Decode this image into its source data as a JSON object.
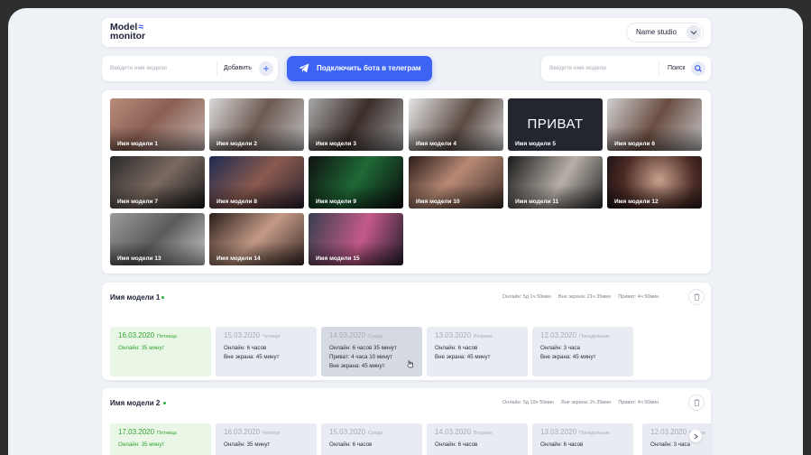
{
  "header": {
    "logo_line1": "Model",
    "logo_line2": "monitor",
    "logo_mark": "≈",
    "studio_name": "Name studio",
    "studio_chevron_icon": "chevron-down-icon"
  },
  "add_model": {
    "placeholder": "Введите имя модели",
    "button_label": "Добавить",
    "button_icon": "+"
  },
  "telegram": {
    "label": "Подключить бота в телеграм",
    "icon": "telegram-plane-icon"
  },
  "search": {
    "placeholder": "Введите имя модели",
    "button_label": "Поиск",
    "icon": "search-icon"
  },
  "gallery": [
    {
      "label": "Имя модели 1"
    },
    {
      "label": "Имя модели 2"
    },
    {
      "label": "Имя модели 3"
    },
    {
      "label": "Имя модели 4"
    },
    {
      "label": "Имя модели 5",
      "private_text": "ПРИВАТ"
    },
    {
      "label": "Имя модели 6"
    },
    {
      "label": "Имя модели 7"
    },
    {
      "label": "Имя модели 8"
    },
    {
      "label": "Имя модели 9"
    },
    {
      "label": "Имя модели 10"
    },
    {
      "label": "Имя модели 11"
    },
    {
      "label": "Имя модели 12"
    },
    {
      "label": "Имя модели 13"
    },
    {
      "label": "Имя модели 14"
    },
    {
      "label": "Имя модели 15"
    }
  ],
  "models": [
    {
      "name": "Имя модели 1",
      "stats": {
        "online": "Онлайн: 5д 1ч 50мин",
        "offscreen": "Вне экрана: 21ч 35мин",
        "private": "Приват: 4ч 50мин"
      },
      "days": [
        {
          "date": "16.03.2020",
          "weekday": "Пятница",
          "lines": [
            "Онлайн: 35 минут"
          ]
        },
        {
          "date": "15.03.2020",
          "weekday": "Четверг",
          "lines": [
            "Онлайн: 6 часов",
            "Вне экрана: 45 минут"
          ]
        },
        {
          "date": "14.03.2020",
          "weekday": "Среда",
          "lines": [
            "Онлайн: 6 часов 35 минут",
            "Приват: 4 часа 10 минут",
            "Вне экрана: 45 минут"
          ]
        },
        {
          "date": "13.03.2020",
          "weekday": "Вторник",
          "lines": [
            "Онлайн: 6 часов",
            "Вне экрана: 45 минут"
          ]
        },
        {
          "date": "12.03.2020",
          "weekday": "Понедельник",
          "lines": [
            "Онлайн: 3 часа",
            "Вне экрана: 45 минут"
          ]
        }
      ]
    },
    {
      "name": "Имя модели 2",
      "stats": {
        "online": "Онлайн: 5д 19ч 50мин",
        "offscreen": "Вне экрана: 2ч 35мин",
        "private": "Приват: 4ч 50мин"
      },
      "days": [
        {
          "date": "17.03.2020",
          "weekday": "Пятница",
          "lines": [
            "Онлайн: 35 минут"
          ]
        },
        {
          "date": "16.03.2020",
          "weekday": "Четверг",
          "lines": [
            "Онлайн: 35 минут"
          ]
        },
        {
          "date": "15.03.2020",
          "weekday": "Среда",
          "lines": [
            "Онлайн: 6 часов"
          ]
        },
        {
          "date": "14.03.2020",
          "weekday": "Вторник",
          "lines": [
            "Онлайн: 6 часов"
          ]
        },
        {
          "date": "13.03.2020",
          "weekday": "Понедельник",
          "lines": [
            "Онлайн: 6 часов"
          ]
        },
        {
          "date": "12.03.2020",
          "weekday": "Воскре",
          "lines": [
            "Онлайн: 3 часа"
          ]
        }
      ]
    }
  ],
  "colors": {
    "accent": "#3d63f5",
    "online_green": "#28b446",
    "today_bg": "#eaf6e6"
  }
}
